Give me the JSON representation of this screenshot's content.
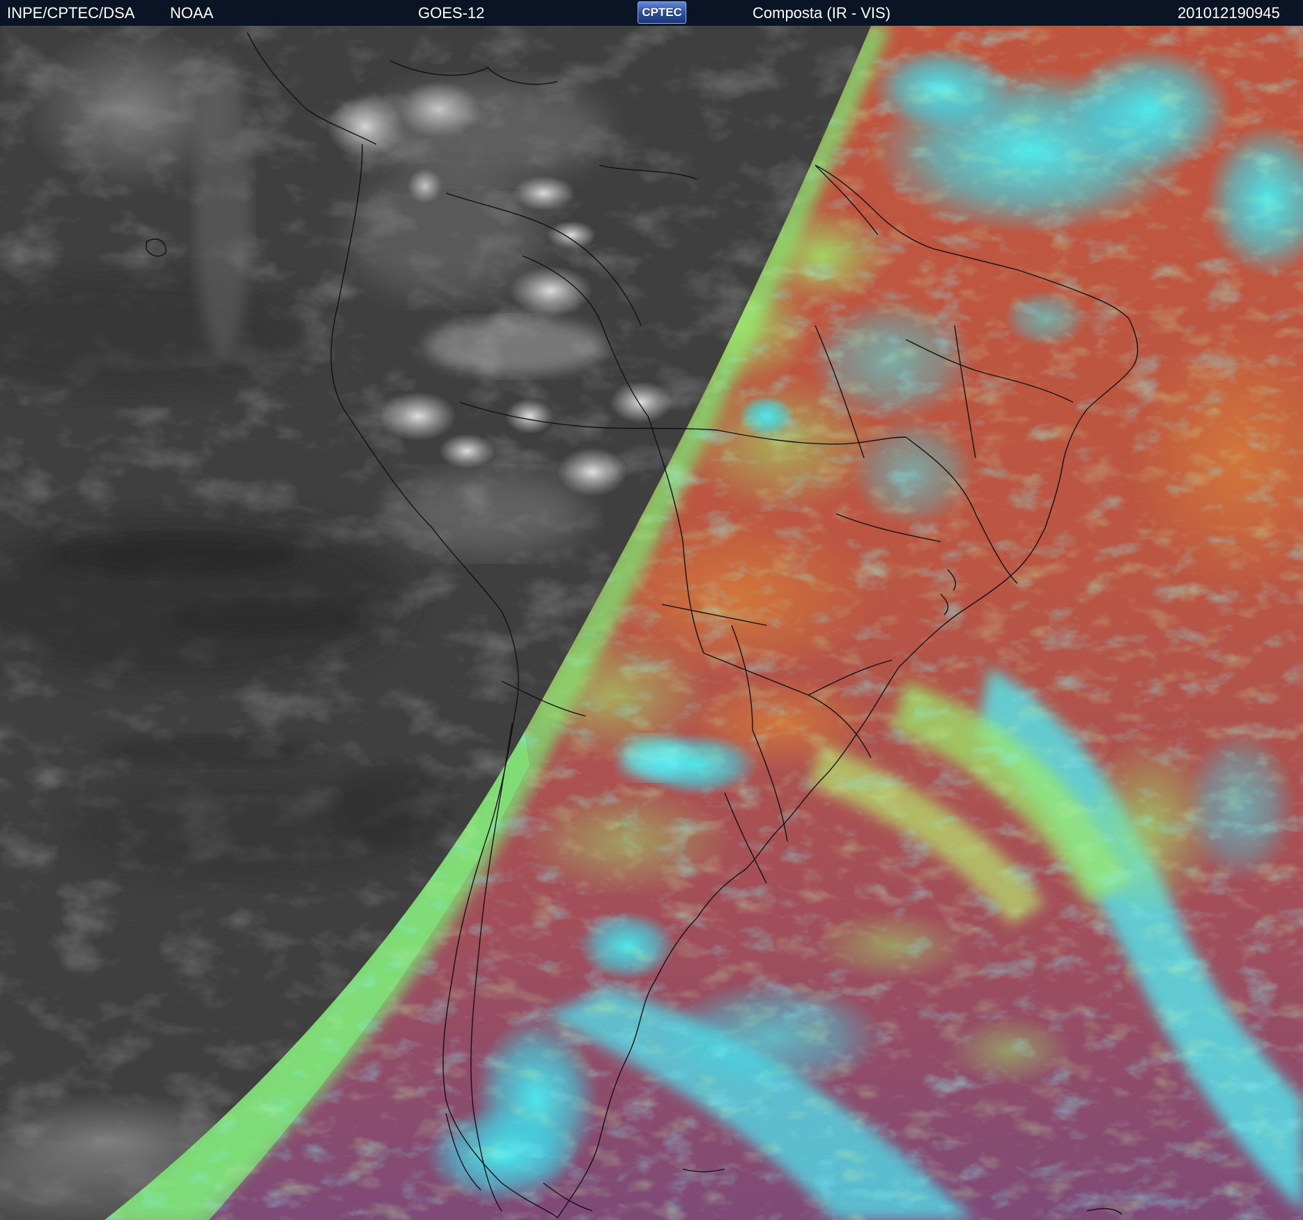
{
  "header": {
    "agency": "INPE/CPTEC/DSA",
    "partner": "NOAA",
    "satellite": "GOES-12",
    "logo_text": "CPTEC",
    "product": "Composta (IR - VIS)",
    "timestamp": "201012190945"
  },
  "image": {
    "left_panel": "infrared-grayscale-night-side",
    "right_panel": "visible-composite-day-side",
    "colors": {
      "night_base": "#3f3f3f",
      "ocean_day": "#b45448",
      "land_day": "#c4643f",
      "cloud_cyan": "#3fe6ef",
      "cloud_green": "#8ee86c",
      "terminator_edge": "#78e874",
      "south_purple": "#8a4c72",
      "border_line": "#111111"
    }
  }
}
